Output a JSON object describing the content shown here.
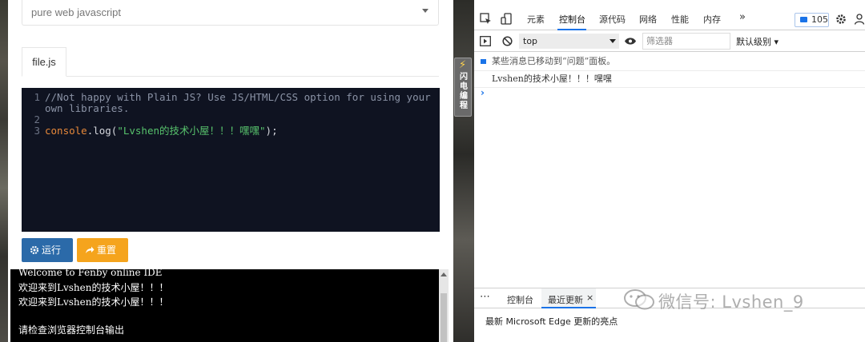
{
  "left_panel": {
    "language_select": {
      "value": "pure web javascript"
    },
    "file_tab": {
      "label": "file.js"
    },
    "editor": {
      "lines": [
        {
          "num": "1",
          "comment": "//Not happy with Plain JS? Use JS/HTML/CSS option for using your"
        },
        {
          "num": "",
          "comment": "own libraries."
        },
        {
          "num": "2"
        },
        {
          "num": "3",
          "obj": "console",
          "dot": ".",
          "method": "log(",
          "string": "\"Lvshen的技术小屋！！！嘿嘿\"",
          "end": ");"
        }
      ]
    },
    "run_button": {
      "label": "运行",
      "color": "#2b6aa9"
    },
    "reset_button": {
      "label": "重置",
      "color": "#f5a41d"
    },
    "console_output": [
      "Welcome to Fenby online IDE",
      "欢迎来到Lvshen的技术小屋！！！",
      "欢迎来到Lvshen的技术小屋！！！",
      "",
      "请检查浏览器控制台输出"
    ]
  },
  "side_badge": {
    "text": "闪电编程",
    "icon": "lightning-icon"
  },
  "devtools": {
    "tabs": [
      "元素",
      "控制台",
      "源代码",
      "网络",
      "性能",
      "内存"
    ],
    "active_tab": "控制台",
    "more_tabs": "»",
    "issues_count": "105",
    "context": "top",
    "filter_placeholder": "筛选器",
    "level": "默认级别 ▾",
    "messages": {
      "info": "某些消息已移动到“问题”面板。",
      "log": "Lvshen的技术小屋！！！嘿嘿"
    },
    "drawer": {
      "tabs": [
        "控制台",
        "最近更新"
      ],
      "active": "最近更新",
      "close": "×",
      "content": "最新 Microsoft Edge 更新的亮点"
    }
  },
  "watermark": {
    "text": "微信号: Lvshen_9"
  },
  "colors": {
    "accent": "#1a73e8",
    "editor_bg": "#0f1321",
    "string": "#57c26c",
    "keyword": "#e8893a"
  }
}
